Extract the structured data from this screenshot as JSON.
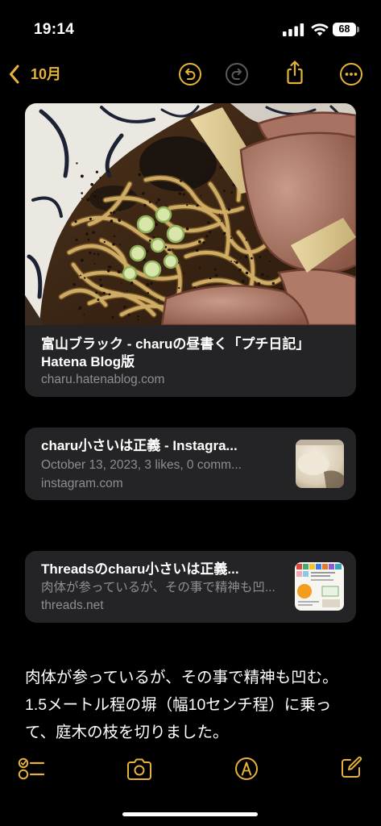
{
  "status_bar": {
    "time": "19:14",
    "battery": "68",
    "icons": [
      "cellular-signal-icon",
      "wifi-icon",
      "battery-icon"
    ]
  },
  "nav": {
    "back_label": "10月",
    "icons": [
      "chevron-left-icon",
      "undo-icon",
      "redo-icon",
      "share-icon",
      "more-icon"
    ]
  },
  "links": [
    {
      "title_lines": [
        "富山ブラック - charuの昼書く「プチ日記」",
        "Hatena Blog版"
      ],
      "domain": "charu.hatenablog.com"
    },
    {
      "title": "charu小さいは正義 - Instagra...",
      "subtitle": "October 13, 2023, 3 likes, 0 comm...",
      "domain": "instagram.com"
    },
    {
      "title": "Threadsのcharu小さいは正義...",
      "subtitle": "肉体が参っているが、その事で精神も凹...",
      "domain": "threads.net"
    }
  ],
  "note_body": {
    "lines": [
      "肉体が参っているが、その事で精神も凹む。",
      "1.5メートル程の塀（幅10センチ程）に乗っ",
      "て、庭木の枝を切りました。"
    ]
  },
  "toolbar": {
    "icons": [
      "checklist-icon",
      "camera-icon",
      "markup-icon",
      "compose-icon"
    ]
  },
  "colors": {
    "accent": "#e5b23a",
    "background": "#000000",
    "card": "#242426",
    "secondary_text": "#8e8e93",
    "disabled_icon": "#5b5b5f"
  }
}
